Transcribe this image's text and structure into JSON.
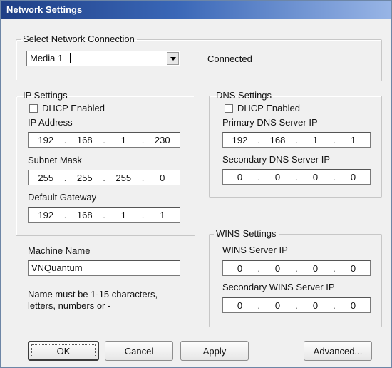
{
  "window": {
    "title": "Network Settings"
  },
  "connection": {
    "legend": "Select Network Connection",
    "selected": "Media 1",
    "status": "Connected"
  },
  "ip_settings": {
    "legend": "IP Settings",
    "dhcp_label": "DHCP Enabled",
    "dhcp_checked": false,
    "ip_address": {
      "label": "IP Address",
      "octets": [
        "192",
        "168",
        "1",
        "230"
      ]
    },
    "subnet_mask": {
      "label": "Subnet Mask",
      "octets": [
        "255",
        "255",
        "255",
        "0"
      ]
    },
    "default_gateway": {
      "label": "Default Gateway",
      "octets": [
        "192",
        "168",
        "1",
        "1"
      ]
    }
  },
  "dns_settings": {
    "legend": "DNS Settings",
    "dhcp_label": "DHCP Enabled",
    "dhcp_checked": false,
    "primary": {
      "label": "Primary DNS Server IP",
      "octets": [
        "192",
        "168",
        "1",
        "1"
      ]
    },
    "secondary": {
      "label": "Secondary DNS Server IP",
      "octets": [
        "0",
        "0",
        "0",
        "0"
      ]
    }
  },
  "machine": {
    "label": "Machine Name",
    "value": "VNQuantum",
    "hint_line1": "Name must be 1-15 characters,",
    "hint_line2": "letters, numbers or -"
  },
  "wins_settings": {
    "legend": "WINS Settings",
    "primary": {
      "label": "WINS Server IP",
      "octets": [
        "0",
        "0",
        "0",
        "0"
      ]
    },
    "secondary": {
      "label": "Secondary WINS Server IP",
      "octets": [
        "0",
        "0",
        "0",
        "0"
      ]
    }
  },
  "buttons": {
    "ok": "OK",
    "cancel": "Cancel",
    "apply": "Apply",
    "advanced": "Advanced..."
  }
}
